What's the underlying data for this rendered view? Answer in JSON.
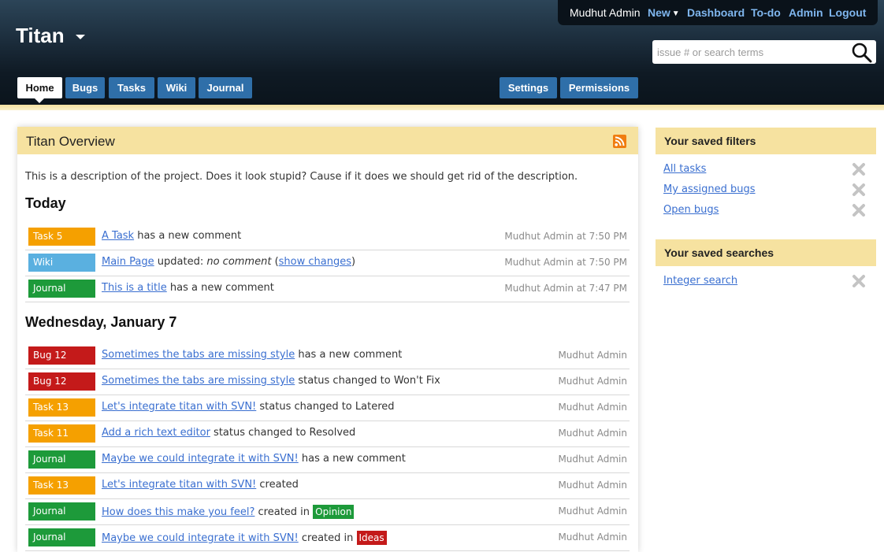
{
  "header": {
    "app_title": "Titan",
    "user": {
      "name": "Mudhut Admin",
      "links": [
        "New",
        "Dashboard",
        "To-do",
        "Admin",
        "Logout"
      ]
    },
    "search": {
      "placeholder": "issue # or search terms",
      "value": ""
    },
    "tabs_left": [
      "Home",
      "Bugs",
      "Tasks",
      "Wiki",
      "Journal"
    ],
    "tabs_right": [
      "Settings",
      "Permissions"
    ],
    "active_tab": "Home"
  },
  "overview": {
    "title": "Titan Overview",
    "description": "This is a description of the project. Does it look stupid? Cause if it does we should get rid of the description.",
    "sections": [
      {
        "heading": "Today",
        "items": [
          {
            "badge": "Task 5",
            "badge_color": "#f5a000",
            "link": "A Task",
            "text": " has a new comment",
            "meta": "Mudhut Admin at 7:50 PM"
          },
          {
            "badge": "Wiki",
            "badge_color": "#5ab0e0",
            "link": "Main Page",
            "text": " updated: ",
            "em": "no comment",
            "paren_link": "show changes",
            "meta": "Mudhut Admin at 7:50 PM"
          },
          {
            "badge": "Journal",
            "badge_color": "#1d9a3a",
            "link": "This is a title",
            "text": " has a new comment",
            "meta": "Mudhut Admin at 7:47 PM"
          }
        ]
      },
      {
        "heading": "Wednesday, January 7",
        "items": [
          {
            "badge": "Bug 12",
            "badge_color": "#c41a1a",
            "link": "Sometimes the tabs are missing style",
            "text": " has a new comment",
            "meta": "Mudhut Admin"
          },
          {
            "badge": "Bug 12",
            "badge_color": "#c41a1a",
            "link": "Sometimes the tabs are missing style",
            "text": " status changed to Won't Fix",
            "meta": "Mudhut Admin"
          },
          {
            "badge": "Task 13",
            "badge_color": "#f5a000",
            "link": "Let's integrate titan with SVN!",
            "text": " status changed to Latered",
            "meta": "Mudhut Admin"
          },
          {
            "badge": "Task 11",
            "badge_color": "#f5a000",
            "link": "Add a rich text editor",
            "text": " status changed to Resolved",
            "meta": "Mudhut Admin"
          },
          {
            "badge": "Journal",
            "badge_color": "#1d9a3a",
            "link": "Maybe we could integrate it with SVN!",
            "text": " has a new comment",
            "meta": "Mudhut Admin"
          },
          {
            "badge": "Task 13",
            "badge_color": "#f5a000",
            "link": "Let's integrate titan with SVN!",
            "text": " created",
            "meta": "Mudhut Admin"
          },
          {
            "badge": "Journal",
            "badge_color": "#1d9a3a",
            "link": "How does this make you feel?",
            "text": " created in ",
            "tag": "Opinion",
            "tag_color": "#1d9a3a",
            "meta": "Mudhut Admin"
          },
          {
            "badge": "Journal",
            "badge_color": "#1d9a3a",
            "link": "Maybe we could integrate it with SVN!",
            "text": " created in ",
            "tag": "Ideas",
            "tag_color": "#c41a1a",
            "meta": "Mudhut Admin"
          }
        ]
      }
    ]
  },
  "sidebar": {
    "filters_title": "Your saved filters",
    "filters": [
      "All tasks",
      "My assigned bugs",
      "Open bugs"
    ],
    "searches_title": "Your saved searches",
    "searches": [
      "Integer search"
    ]
  },
  "colors": {
    "header_dark": "#0f1a24",
    "tab_blue": "#2f6fa9",
    "panel_header": "#f6e2a0",
    "link": "#3a6fd0"
  }
}
